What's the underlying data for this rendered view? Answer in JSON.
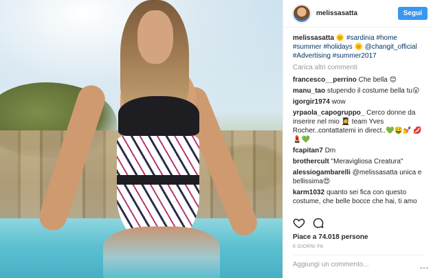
{
  "post": {
    "username": "melissasatta",
    "follow_label": "Segui",
    "caption": {
      "username": "melissasatta",
      "text": "🌞 #sardinia #home #summer #holidays 🌞 @changit_official #Advertising #summer2017"
    },
    "load_more": "Carica altri commenti",
    "comments": [
      {
        "user": "francesco__perrino",
        "text": "Che bella 😊"
      },
      {
        "user": "manu_tao",
        "text": "stupendo il costume bella tu😮"
      },
      {
        "user": "igorgir1974",
        "text": "wow"
      },
      {
        "user": "yrpaola_capogruppo_",
        "text": "Cerco donne da inserire nel mio 👩‍🎓 team Yves Rocher..contattatemi in direct..💚🤑💅 💋💄💚"
      },
      {
        "user": "fcapitan7",
        "text": "Dm"
      },
      {
        "user": "brothercult",
        "text": "\"Meravigliosa Creatura\""
      },
      {
        "user": "alessiogambarelli",
        "text": "@melissasatta unica e bellissima😍"
      },
      {
        "user": "karm1032",
        "text": "quanto sei fica con questo costume, che belle bocce che hai, ti amo"
      }
    ],
    "likes": "Piace a 74.018 persone",
    "time": "6 GIORNI FA",
    "add_comment_placeholder": "Aggiungi un commento...",
    "more_label": "..."
  },
  "icons": {
    "like": "heart-icon",
    "comment": "comment-bubble-icon",
    "more": "more-options-icon"
  },
  "colors": {
    "follow_button": "#3897f0",
    "hashtag": "#003569",
    "secondary_text": "#999999"
  }
}
